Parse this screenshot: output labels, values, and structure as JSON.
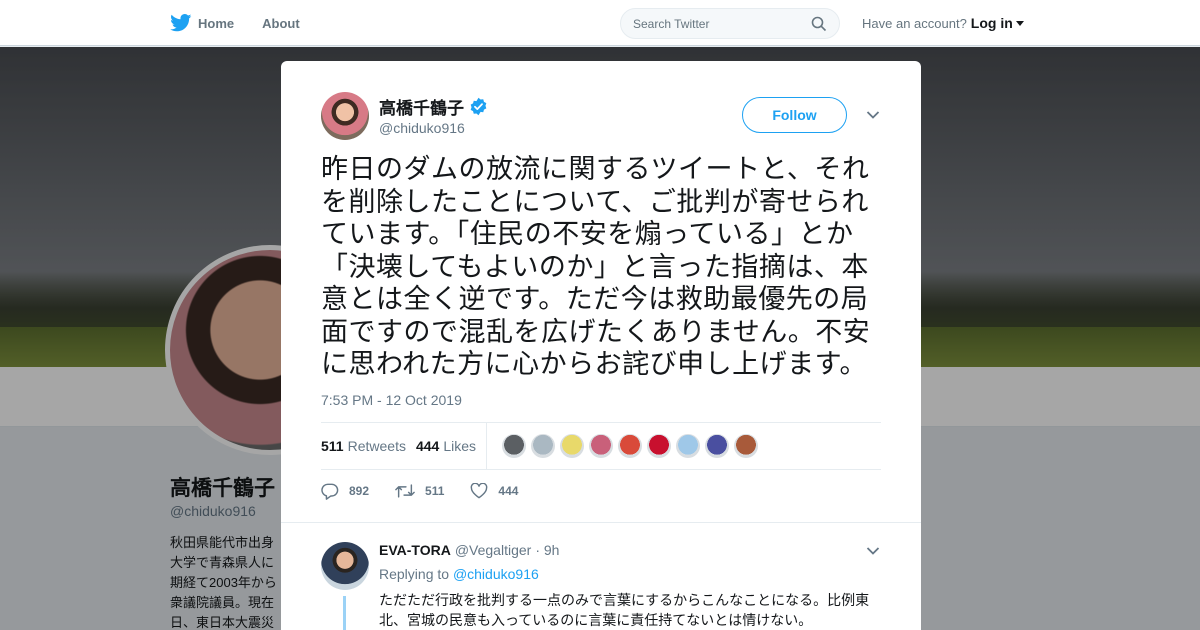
{
  "nav": {
    "home": "Home",
    "about": "About",
    "search_placeholder": "Search Twitter",
    "have_account": "Have an account?",
    "login": "Log in"
  },
  "profile": {
    "name": "高橋千鶴子",
    "handle": "@chiduko916",
    "bio": "秋田県能代市出身 大学で青森県人に 期経て2003年から 衆議院議員。現在 日、東日本大震災"
  },
  "tweet": {
    "author_name": "高橋千鶴子",
    "author_handle": "@chiduko916",
    "follow_label": "Follow",
    "text": "昨日のダムの放流に関するツイートと、それを削除したことについて、ご批判が寄せられています。「住民の不安を煽っている」とか「決壊してもよいのか」と言った指摘は、本意とは全く逆です。ただ今は救助最優先の局面ですので混乱を広げたくありません。不安に思われた方に心からお詫び申し上げます。",
    "timestamp": "7:53 PM - 12 Oct 2019",
    "retweets_count": "511",
    "retweets_label": "Retweets",
    "likes_count": "444",
    "likes_label": "Likes",
    "reply_action_count": "892",
    "retweet_action_count": "511",
    "like_action_count": "444"
  },
  "likers": [
    {
      "color": "#5b5f63"
    },
    {
      "color": "#aab8c2"
    },
    {
      "color": "#e8d96a"
    },
    {
      "color": "#c9607a"
    },
    {
      "color": "#d94a3a"
    },
    {
      "color": "#c8102e"
    },
    {
      "color": "#9fc8e8"
    },
    {
      "color": "#4a4fa0"
    },
    {
      "color": "#a85a3a"
    }
  ],
  "reply": {
    "name": "EVA-TORA",
    "handle": "@Vegaltiger",
    "time": "· 9h",
    "replying_prefix": "Replying to",
    "replying_to": "@chiduko916",
    "text": "ただただ行政を批判する一点のみで言葉にするからこんなことになる。比例東北、宮城の民意も入っているのに言葉に責任持てないとは情けない。"
  },
  "colors": {
    "accent": "#1da1f2",
    "text_secondary": "#657786"
  }
}
